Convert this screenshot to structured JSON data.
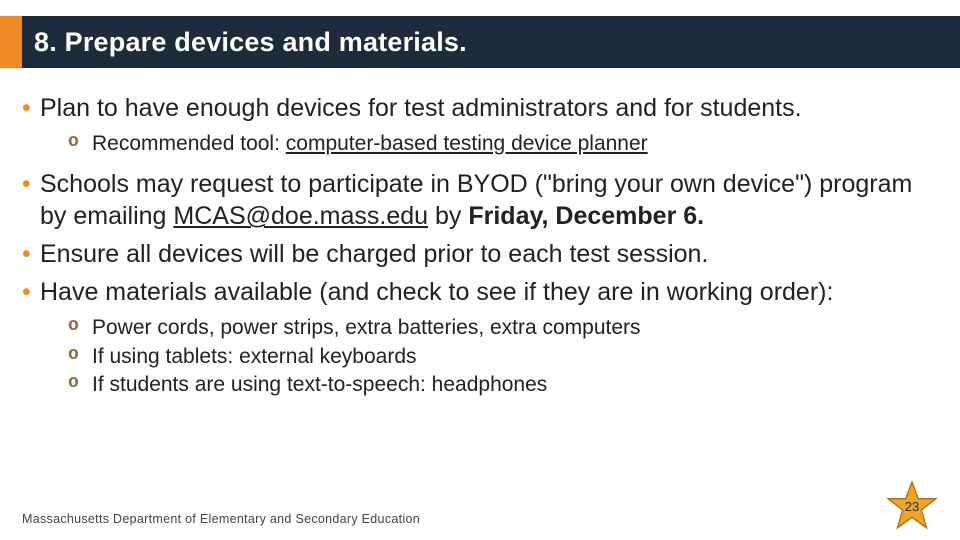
{
  "title": "8. Prepare devices and materials.",
  "bullets": [
    {
      "text": "Plan to have enough devices for test administrators and for students.",
      "sub": [
        {
          "prefix": "Recommended tool: ",
          "link": "computer-based testing device planner"
        }
      ]
    },
    {
      "prefix": "Schools may request to participate in BYOD (\"bring your own device\") program by emailing ",
      "email": "MCAS@doe.mass.edu",
      "mid": " by ",
      "bold": "Friday, December 6."
    },
    {
      "text": "Ensure all devices will be charged prior to each test session."
    },
    {
      "text": "Have materials available (and check to see if they are in working order):",
      "sub": [
        {
          "text": "Power cords, power strips, extra batteries, extra computers"
        },
        {
          "text": "If using tablets: external keyboards"
        },
        {
          "text": "If students are using text-to-speech: headphones"
        }
      ]
    }
  ],
  "footer": "Massachusetts Department of Elementary and Secondary Education",
  "page_number": "23",
  "colors": {
    "accent": "#ed8b22",
    "header": "#1e2b3b",
    "star_fill": "#eda427",
    "star_stroke": "#b36d12"
  }
}
